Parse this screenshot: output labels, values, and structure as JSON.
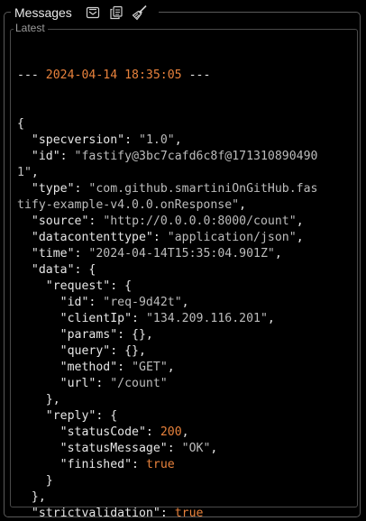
{
  "header": {
    "title": "Messages",
    "icons": [
      "clear-icon",
      "copy-icon",
      "broom-icon"
    ]
  },
  "section": {
    "label": "Latest"
  },
  "log": {
    "separator_prefix": "--- ",
    "timestamp": "2024-04-14 18:35:05",
    "separator_suffix": " ---",
    "lines": [
      [
        {
          "t": "p",
          "v": "{"
        }
      ],
      [
        {
          "t": "p",
          "v": "  "
        },
        {
          "t": "k",
          "v": "\"specversion\""
        },
        {
          "t": "p",
          "v": ": "
        },
        {
          "t": "s",
          "v": "\"1.0\""
        },
        {
          "t": "p",
          "v": ","
        }
      ],
      [
        {
          "t": "p",
          "v": "  "
        },
        {
          "t": "k",
          "v": "\"id\""
        },
        {
          "t": "p",
          "v": ": "
        },
        {
          "t": "s",
          "v": "\"fastify@3bc7cafd6c8f@171310890490"
        }
      ],
      [
        {
          "t": "s",
          "v": "1\""
        },
        {
          "t": "p",
          "v": ","
        }
      ],
      [
        {
          "t": "p",
          "v": "  "
        },
        {
          "t": "k",
          "v": "\"type\""
        },
        {
          "t": "p",
          "v": ": "
        },
        {
          "t": "s",
          "v": "\"com.github.smartiniOnGitHub.fas"
        }
      ],
      [
        {
          "t": "s",
          "v": "tify-example-v4.0.0.onResponse\""
        },
        {
          "t": "p",
          "v": ","
        }
      ],
      [
        {
          "t": "p",
          "v": "  "
        },
        {
          "t": "k",
          "v": "\"source\""
        },
        {
          "t": "p",
          "v": ": "
        },
        {
          "t": "s",
          "v": "\"http://0.0.0.0:8000/count\""
        },
        {
          "t": "p",
          "v": ","
        }
      ],
      [
        {
          "t": "p",
          "v": "  "
        },
        {
          "t": "k",
          "v": "\"datacontenttype\""
        },
        {
          "t": "p",
          "v": ": "
        },
        {
          "t": "s",
          "v": "\"application/json\""
        },
        {
          "t": "p",
          "v": ","
        }
      ],
      [
        {
          "t": "p",
          "v": "  "
        },
        {
          "t": "k",
          "v": "\"time\""
        },
        {
          "t": "p",
          "v": ": "
        },
        {
          "t": "s",
          "v": "\"2024-04-14T15:35:04.901Z\""
        },
        {
          "t": "p",
          "v": ","
        }
      ],
      [
        {
          "t": "p",
          "v": "  "
        },
        {
          "t": "k",
          "v": "\"data\""
        },
        {
          "t": "p",
          "v": ": {"
        }
      ],
      [
        {
          "t": "p",
          "v": "    "
        },
        {
          "t": "k",
          "v": "\"request\""
        },
        {
          "t": "p",
          "v": ": {"
        }
      ],
      [
        {
          "t": "p",
          "v": "      "
        },
        {
          "t": "k",
          "v": "\"id\""
        },
        {
          "t": "p",
          "v": ": "
        },
        {
          "t": "s",
          "v": "\"req-9d42t\""
        },
        {
          "t": "p",
          "v": ","
        }
      ],
      [
        {
          "t": "p",
          "v": "      "
        },
        {
          "t": "k",
          "v": "\"clientIp\""
        },
        {
          "t": "p",
          "v": ": "
        },
        {
          "t": "s",
          "v": "\"134.209.116.201\""
        },
        {
          "t": "p",
          "v": ","
        }
      ],
      [
        {
          "t": "p",
          "v": "      "
        },
        {
          "t": "k",
          "v": "\"params\""
        },
        {
          "t": "p",
          "v": ": {},"
        }
      ],
      [
        {
          "t": "p",
          "v": "      "
        },
        {
          "t": "k",
          "v": "\"query\""
        },
        {
          "t": "p",
          "v": ": {},"
        }
      ],
      [
        {
          "t": "p",
          "v": "      "
        },
        {
          "t": "k",
          "v": "\"method\""
        },
        {
          "t": "p",
          "v": ": "
        },
        {
          "t": "s",
          "v": "\"GET\""
        },
        {
          "t": "p",
          "v": ","
        }
      ],
      [
        {
          "t": "p",
          "v": "      "
        },
        {
          "t": "k",
          "v": "\"url\""
        },
        {
          "t": "p",
          "v": ": "
        },
        {
          "t": "s",
          "v": "\"/count\""
        }
      ],
      [
        {
          "t": "p",
          "v": "    },"
        }
      ],
      [
        {
          "t": "p",
          "v": "    "
        },
        {
          "t": "k",
          "v": "\"reply\""
        },
        {
          "t": "p",
          "v": ": {"
        }
      ],
      [
        {
          "t": "p",
          "v": "      "
        },
        {
          "t": "k",
          "v": "\"statusCode\""
        },
        {
          "t": "p",
          "v": ": "
        },
        {
          "t": "n",
          "v": "200"
        },
        {
          "t": "p",
          "v": ","
        }
      ],
      [
        {
          "t": "p",
          "v": "      "
        },
        {
          "t": "k",
          "v": "\"statusMessage\""
        },
        {
          "t": "p",
          "v": ": "
        },
        {
          "t": "s",
          "v": "\"OK\""
        },
        {
          "t": "p",
          "v": ","
        }
      ],
      [
        {
          "t": "p",
          "v": "      "
        },
        {
          "t": "k",
          "v": "\"finished\""
        },
        {
          "t": "p",
          "v": ": "
        },
        {
          "t": "b",
          "v": "true"
        }
      ],
      [
        {
          "t": "p",
          "v": "    }"
        }
      ],
      [
        {
          "t": "p",
          "v": "  },"
        }
      ],
      [
        {
          "t": "p",
          "v": "  "
        },
        {
          "t": "k",
          "v": "\"strictvalidation\""
        },
        {
          "t": "p",
          "v": ": "
        },
        {
          "t": "b",
          "v": "true"
        }
      ],
      [
        {
          "t": "p",
          "v": "}"
        }
      ]
    ]
  },
  "colors": {
    "background": "#000000",
    "text": "#e6e6e6",
    "string": "#bcbcbc",
    "accent": "#e8823c",
    "border": "#5a5a5a"
  }
}
